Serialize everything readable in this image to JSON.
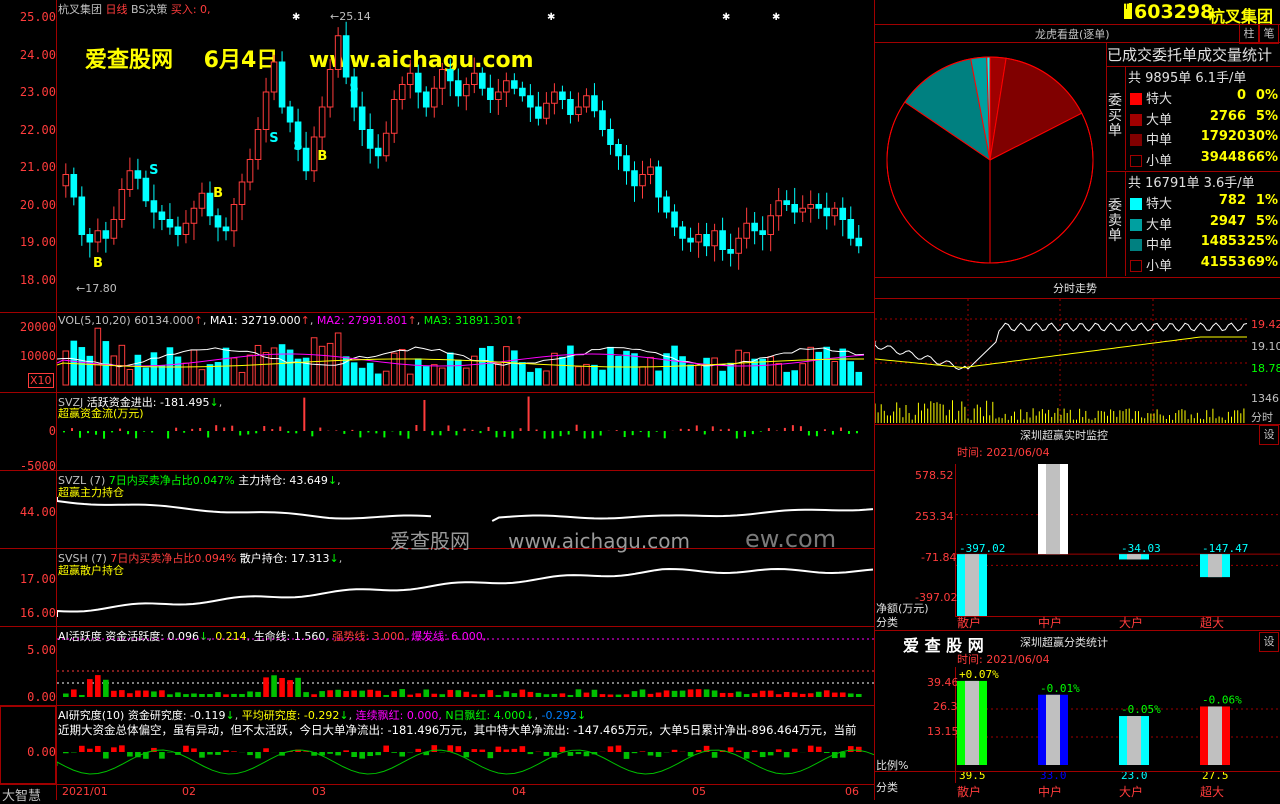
{
  "main": {
    "title": "杭叉集团",
    "period": "日线",
    "indicator": "BS决策",
    "buy_label": "买入: 0,",
    "y_ticks": [
      "25.00",
      "24.00",
      "23.00",
      "22.00",
      "21.00",
      "20.00",
      "19.00",
      "18.00"
    ],
    "high_mark": "25.14",
    "low_mark": "17.80",
    "watermark_top": "爱查股网    6月4日    www.aichagu.com",
    "watermark_mid": "爱查股网      www.aichagu.com",
    "watermark_mid2": "ew.com",
    "signals": {
      "b": "B",
      "s": "S"
    }
  },
  "vol": {
    "header": "VOL(5,10,20)",
    "value": "60134.000",
    "ma1": "MA1: 32719.000",
    "ma2": "MA2: 27991.801",
    "ma3": "MA3: 31891.301",
    "y_ticks": [
      "20000",
      "10000"
    ],
    "unit": "X10"
  },
  "svzj": {
    "name": "SVZJ",
    "label": "活跃资金进出: -181.495",
    "sub": "超赢资金流(万元)",
    "y_ticks": [
      "0",
      "-5000"
    ]
  },
  "svzl": {
    "name": "SVZL (7)",
    "label": "7日内买卖净占比0.047%",
    "label2": "主力持仓: 43.649",
    "sub": "超赢主力持仓",
    "y_ticks": [
      "44.00"
    ]
  },
  "svsh": {
    "name": "SVSH (7)",
    "label": "7日内买卖净占比0.094%",
    "label2": "散户持仓: 17.313",
    "sub": "超赢散户持仓",
    "y_ticks": [
      "17.00",
      "16.00"
    ]
  },
  "ai": {
    "label": "AI活跃度 资金活跃度: 0.096",
    "v2": "0.214",
    "life": "生命线: 1.560,",
    "strong": "强势线: 3.000,",
    "burst": "爆发线: 6.000,",
    "y_ticks": [
      "5.00",
      "0.00"
    ]
  },
  "study": {
    "label": "AI研究度(10) 资金研究度: -0.119",
    "avg": "平均研究度: -0.292",
    "cont": "连续飘红: 0.000,",
    "n": "N日飘红: 4.000",
    "last": "-0.292",
    "commentary": "近期大资金总体偏空，虽有异动，但不太活跃，今日大单净流出: -181.496万元，其中特大单净流出: -147.465万元，大单5日累计净出-896.464万元，当前",
    "y_ticks": [
      "0.00"
    ]
  },
  "xaxis": {
    "labels": [
      "2021/01",
      "02",
      "03",
      "04",
      "05",
      "06"
    ],
    "corner": "大智慧"
  },
  "right": {
    "code": "603298",
    "name": "杭叉集团",
    "tab1": "柱",
    "tab2": "笔",
    "dragon_title": "龙虎看盘(逐单)",
    "stats_title": "已成交委托单成交量统计",
    "buy": {
      "side": "委买单",
      "total": "共 9895单 6.1手/单",
      "rows": [
        {
          "label": "特大",
          "count": "0",
          "pct": "0%",
          "color": "#ff0000"
        },
        {
          "label": "大单",
          "count": "2766",
          "pct": "5%",
          "color": "#a00000"
        },
        {
          "label": "中单",
          "count": "17920",
          "pct": "30%",
          "color": "#800000"
        },
        {
          "label": "小单",
          "count": "39448",
          "pct": "66%",
          "color": "#000000"
        }
      ]
    },
    "sell": {
      "side": "委卖单",
      "total": "共 16791单 3.6手/单",
      "rows": [
        {
          "label": "特大",
          "count": "782",
          "pct": "1%",
          "color": "#00ffff"
        },
        {
          "label": "大单",
          "count": "2947",
          "pct": "5%",
          "color": "#00a0a0"
        },
        {
          "label": "中单",
          "count": "14853",
          "pct": "25%",
          "color": "#008080"
        },
        {
          "label": "小单",
          "count": "41553",
          "pct": "69%",
          "color": "#000000"
        }
      ]
    },
    "intraday": {
      "title": "分时走势",
      "ticks": [
        "19.42",
        "19.10",
        "18.78"
      ],
      "vol": "1346",
      "fen": "分时"
    },
    "monitor": {
      "title": "深圳超赢实时监控",
      "settings": "设",
      "time": "时间: 2021/06/04",
      "y_ticks": [
        "578.52",
        "253.34",
        "-71.84",
        "-397.02"
      ],
      "values": [
        "-397.02",
        "578.52",
        "-34.03",
        "-147.47"
      ],
      "unit": "净额(万元)",
      "cat_label": "分类",
      "cats": [
        "散户",
        "中户",
        "大户",
        "超大"
      ]
    },
    "classify": {
      "brand": "爱 查 股 网",
      "title": "深圳超赢分类统计",
      "settings": "设",
      "time": "时间: 2021/06/04",
      "y_ticks": [
        "39.46",
        "26.3",
        "13.15"
      ],
      "changes": [
        "+0.07%",
        "-0.01%",
        "-0.05%",
        "-0.06%"
      ],
      "values": [
        "39.5",
        "33.0",
        "23.0",
        "27.5"
      ],
      "ratio_label": "比例%",
      "cat_label": "分类",
      "cats": [
        "散户",
        "中户",
        "大户",
        "超大"
      ]
    }
  },
  "colors": {
    "up": "#ff3c3c",
    "down": "#00ffff",
    "grid": "#a00000",
    "yellow": "#ffff00"
  }
}
